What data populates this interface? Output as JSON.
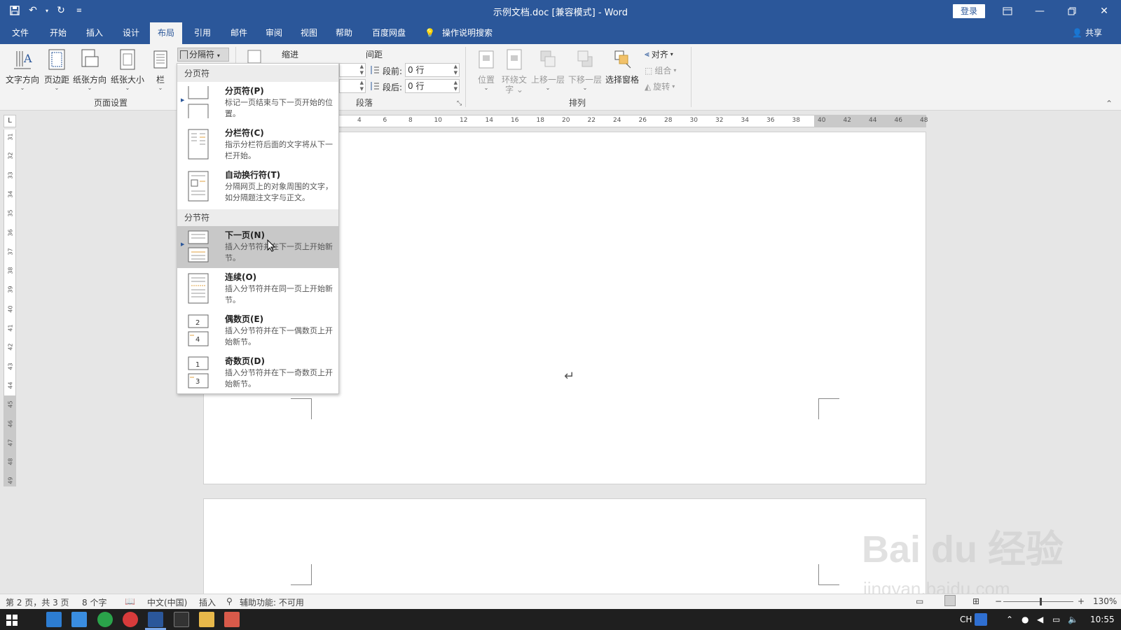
{
  "window": {
    "title": "示例文档.doc [兼容模式]  -  Word",
    "login": "登录"
  },
  "tabs": [
    "文件",
    "开始",
    "插入",
    "设计",
    "布局",
    "引用",
    "邮件",
    "审阅",
    "视图",
    "帮助",
    "百度网盘"
  ],
  "active_tab": "布局",
  "tell_me": "操作说明搜索",
  "share": "共享",
  "ribbon": {
    "page_setup": {
      "buttons": [
        "文字方向",
        "页边距",
        "纸张方向",
        "纸张大小",
        "栏"
      ],
      "label": "页面设置"
    },
    "breaks_label": "分隔符",
    "paragraph": {
      "indent_label": "缩进",
      "spacing_label": "间距",
      "before_label": "段前:",
      "before_value": "0 行",
      "after_label": "段后:",
      "after_value": "0 行",
      "label": "段落"
    },
    "arrange": {
      "position": "位置",
      "wrap_text_l1": "环绕文",
      "wrap_text_l2": "字",
      "bring_forward": "上移一层",
      "send_backward": "下移一层",
      "selection_pane": "选择窗格",
      "align": "对齐",
      "group": "组合",
      "rotate": "旋转",
      "label": "排列"
    }
  },
  "ruler": {
    "corner": "L",
    "h_ticks": [
      "4",
      "6",
      "8",
      "10",
      "12",
      "14",
      "16",
      "18",
      "20",
      "22",
      "24",
      "26",
      "28",
      "30",
      "32",
      "34",
      "36",
      "38",
      "40",
      "42",
      "44",
      "46",
      "48"
    ],
    "v_ticks": [
      "31",
      "32",
      "33",
      "34",
      "35",
      "36",
      "37",
      "38",
      "39",
      "40",
      "41",
      "42",
      "43",
      "44",
      "45",
      "46",
      "47",
      "48",
      "49"
    ]
  },
  "dropdown": {
    "page_breaks_header": "分页符",
    "section_breaks_header": "分节符",
    "page_items": [
      {
        "title": "分页符(P)",
        "desc": "标记一页结束与下一页开始的位置。"
      },
      {
        "title": "分栏符(C)",
        "desc": "指示分栏符后面的文字将从下一栏开始。"
      },
      {
        "title": "自动换行符(T)",
        "desc": "分隔网页上的对象周围的文字，如分隔题注文字与正文。"
      }
    ],
    "section_items": [
      {
        "title": "下一页(N)",
        "desc": "插入分节符并在下一页上开始新节。"
      },
      {
        "title": "连续(O)",
        "desc": "插入分节符并在同一页上开始新节。"
      },
      {
        "title": "偶数页(E)",
        "desc": "插入分节符并在下一偶数页上开始新节。"
      },
      {
        "title": "奇数页(D)",
        "desc": "插入分节符并在下一奇数页上开始新节。"
      }
    ]
  },
  "paragraph_mark": "↵",
  "status": {
    "page": "第 2 页，共 3 页",
    "words": "8 个字",
    "language": "中文(中国)",
    "mode": "插入",
    "accessibility": "辅助功能: 不可用",
    "zoom": "130%"
  },
  "taskbar": {
    "ime": "CH",
    "time": "10:55"
  },
  "watermark": {
    "main": "Bai du 经验",
    "sub": "jingyan.baidu.com"
  },
  "colors": {
    "word_blue": "#2b579a",
    "hover_gray": "#c8c8c8"
  }
}
